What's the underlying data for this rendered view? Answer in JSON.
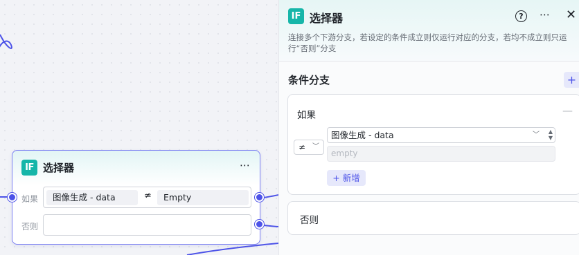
{
  "node": {
    "logo_text": "IF",
    "title": "选择器",
    "more": "⋯",
    "if_label": "如果",
    "else_label": "否则",
    "condition": {
      "variable": "图像生成 - data",
      "operator": "≄",
      "value": "Empty"
    },
    "else_value": ""
  },
  "panel": {
    "logo_text": "IF",
    "title": "选择器",
    "help": "?",
    "more": "⋯",
    "close": "✕",
    "description": "连接多个下游分支，若设定的条件成立则仅运行对应的分支，若均不成立则只运行“否则”分支",
    "section_title": "条件分支",
    "section_add": "+",
    "if_card": {
      "label": "如果",
      "collapse": "—",
      "operator": "≄",
      "variable": "图像生成 - data",
      "value_placeholder": "empty",
      "add_button": "+ 新增"
    },
    "else_card": {
      "label": "否则"
    }
  },
  "colors": {
    "accent": "#4d53e8",
    "logo": "#16b6a9",
    "node_border": "#7b7ff2"
  }
}
